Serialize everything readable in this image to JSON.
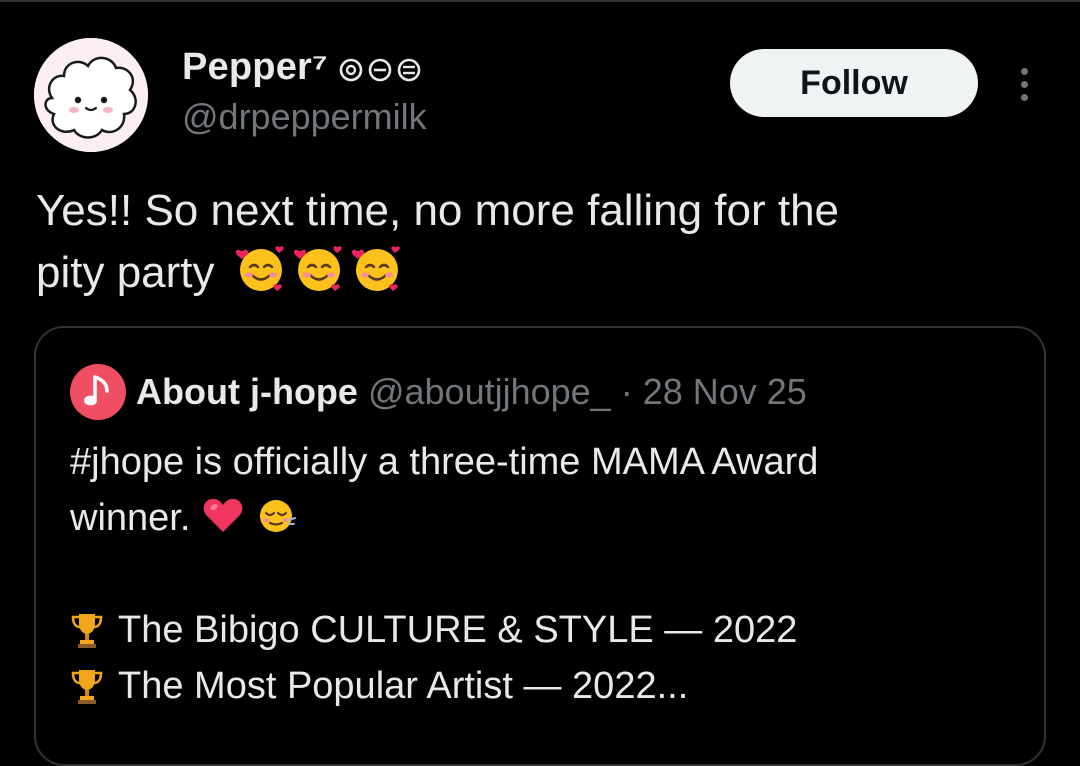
{
  "post": {
    "author": {
      "display_name": "Pepper⁷",
      "name_glyphs": [
        "ring-icon",
        "minus-circle-icon",
        "equals-circle-icon"
      ],
      "handle": "@drpeppermilk",
      "avatar_icon": "bt21-rj-avatar"
    },
    "follow_label": "Follow",
    "text_line1": "Yes!! So next time, no more falling for the",
    "text_line2": "pity party",
    "emoji": [
      "smiling-face-with-hearts",
      "smiling-face-with-hearts",
      "smiling-face-with-hearts"
    ]
  },
  "quote": {
    "author": {
      "name": "About j-hope",
      "handle": "@aboutjjhope_",
      "separator": "·",
      "date": "28 Nov 25",
      "avatar_icon": "music-note-avatar"
    },
    "line1": "#jhope is officially a three-time MAMA Award",
    "line2": "winner.",
    "line2_emoji": [
      "pink-heart",
      "relieved-face"
    ],
    "awards": [
      {
        "icon": "trophy",
        "text": "The Bibigo CULTURE & STYLE — 2022"
      },
      {
        "icon": "trophy",
        "text": "The Most Popular Artist — 2022..."
      }
    ]
  },
  "colors": {
    "background": "#000000",
    "text_primary": "#e7e9ea",
    "text_secondary": "#71767b",
    "border": "#2f3336",
    "follow_bg": "#eff3f4",
    "follow_text": "#0f1419",
    "quote_avatar": "#f04e63"
  }
}
